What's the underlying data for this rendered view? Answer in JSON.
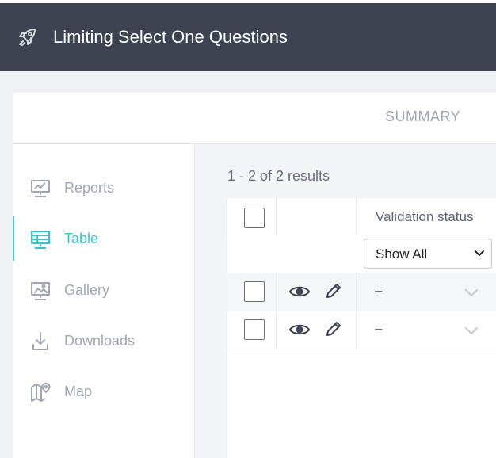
{
  "header": {
    "title": "Limiting Select One Questions",
    "logo_icon": "rocket-icon"
  },
  "tabs": {
    "summary_label": "SUMMARY"
  },
  "sidebar": {
    "items": [
      {
        "label": "Reports",
        "icon": "reports-icon",
        "active": false
      },
      {
        "label": "Table",
        "icon": "table-icon",
        "active": true
      },
      {
        "label": "Gallery",
        "icon": "gallery-icon",
        "active": false
      },
      {
        "label": "Downloads",
        "icon": "download-icon",
        "active": false
      },
      {
        "label": "Map",
        "icon": "map-icon",
        "active": false
      }
    ]
  },
  "table": {
    "results_text": "1 - 2 of 2 results",
    "column_header": "Validation status",
    "filter_value": "Show All",
    "rows": [
      {
        "validation": "–"
      },
      {
        "validation": "–"
      }
    ]
  },
  "colors": {
    "header_bg": "#3e4251",
    "accent": "#3ac2c9",
    "muted_text": "#a2a6b3"
  }
}
